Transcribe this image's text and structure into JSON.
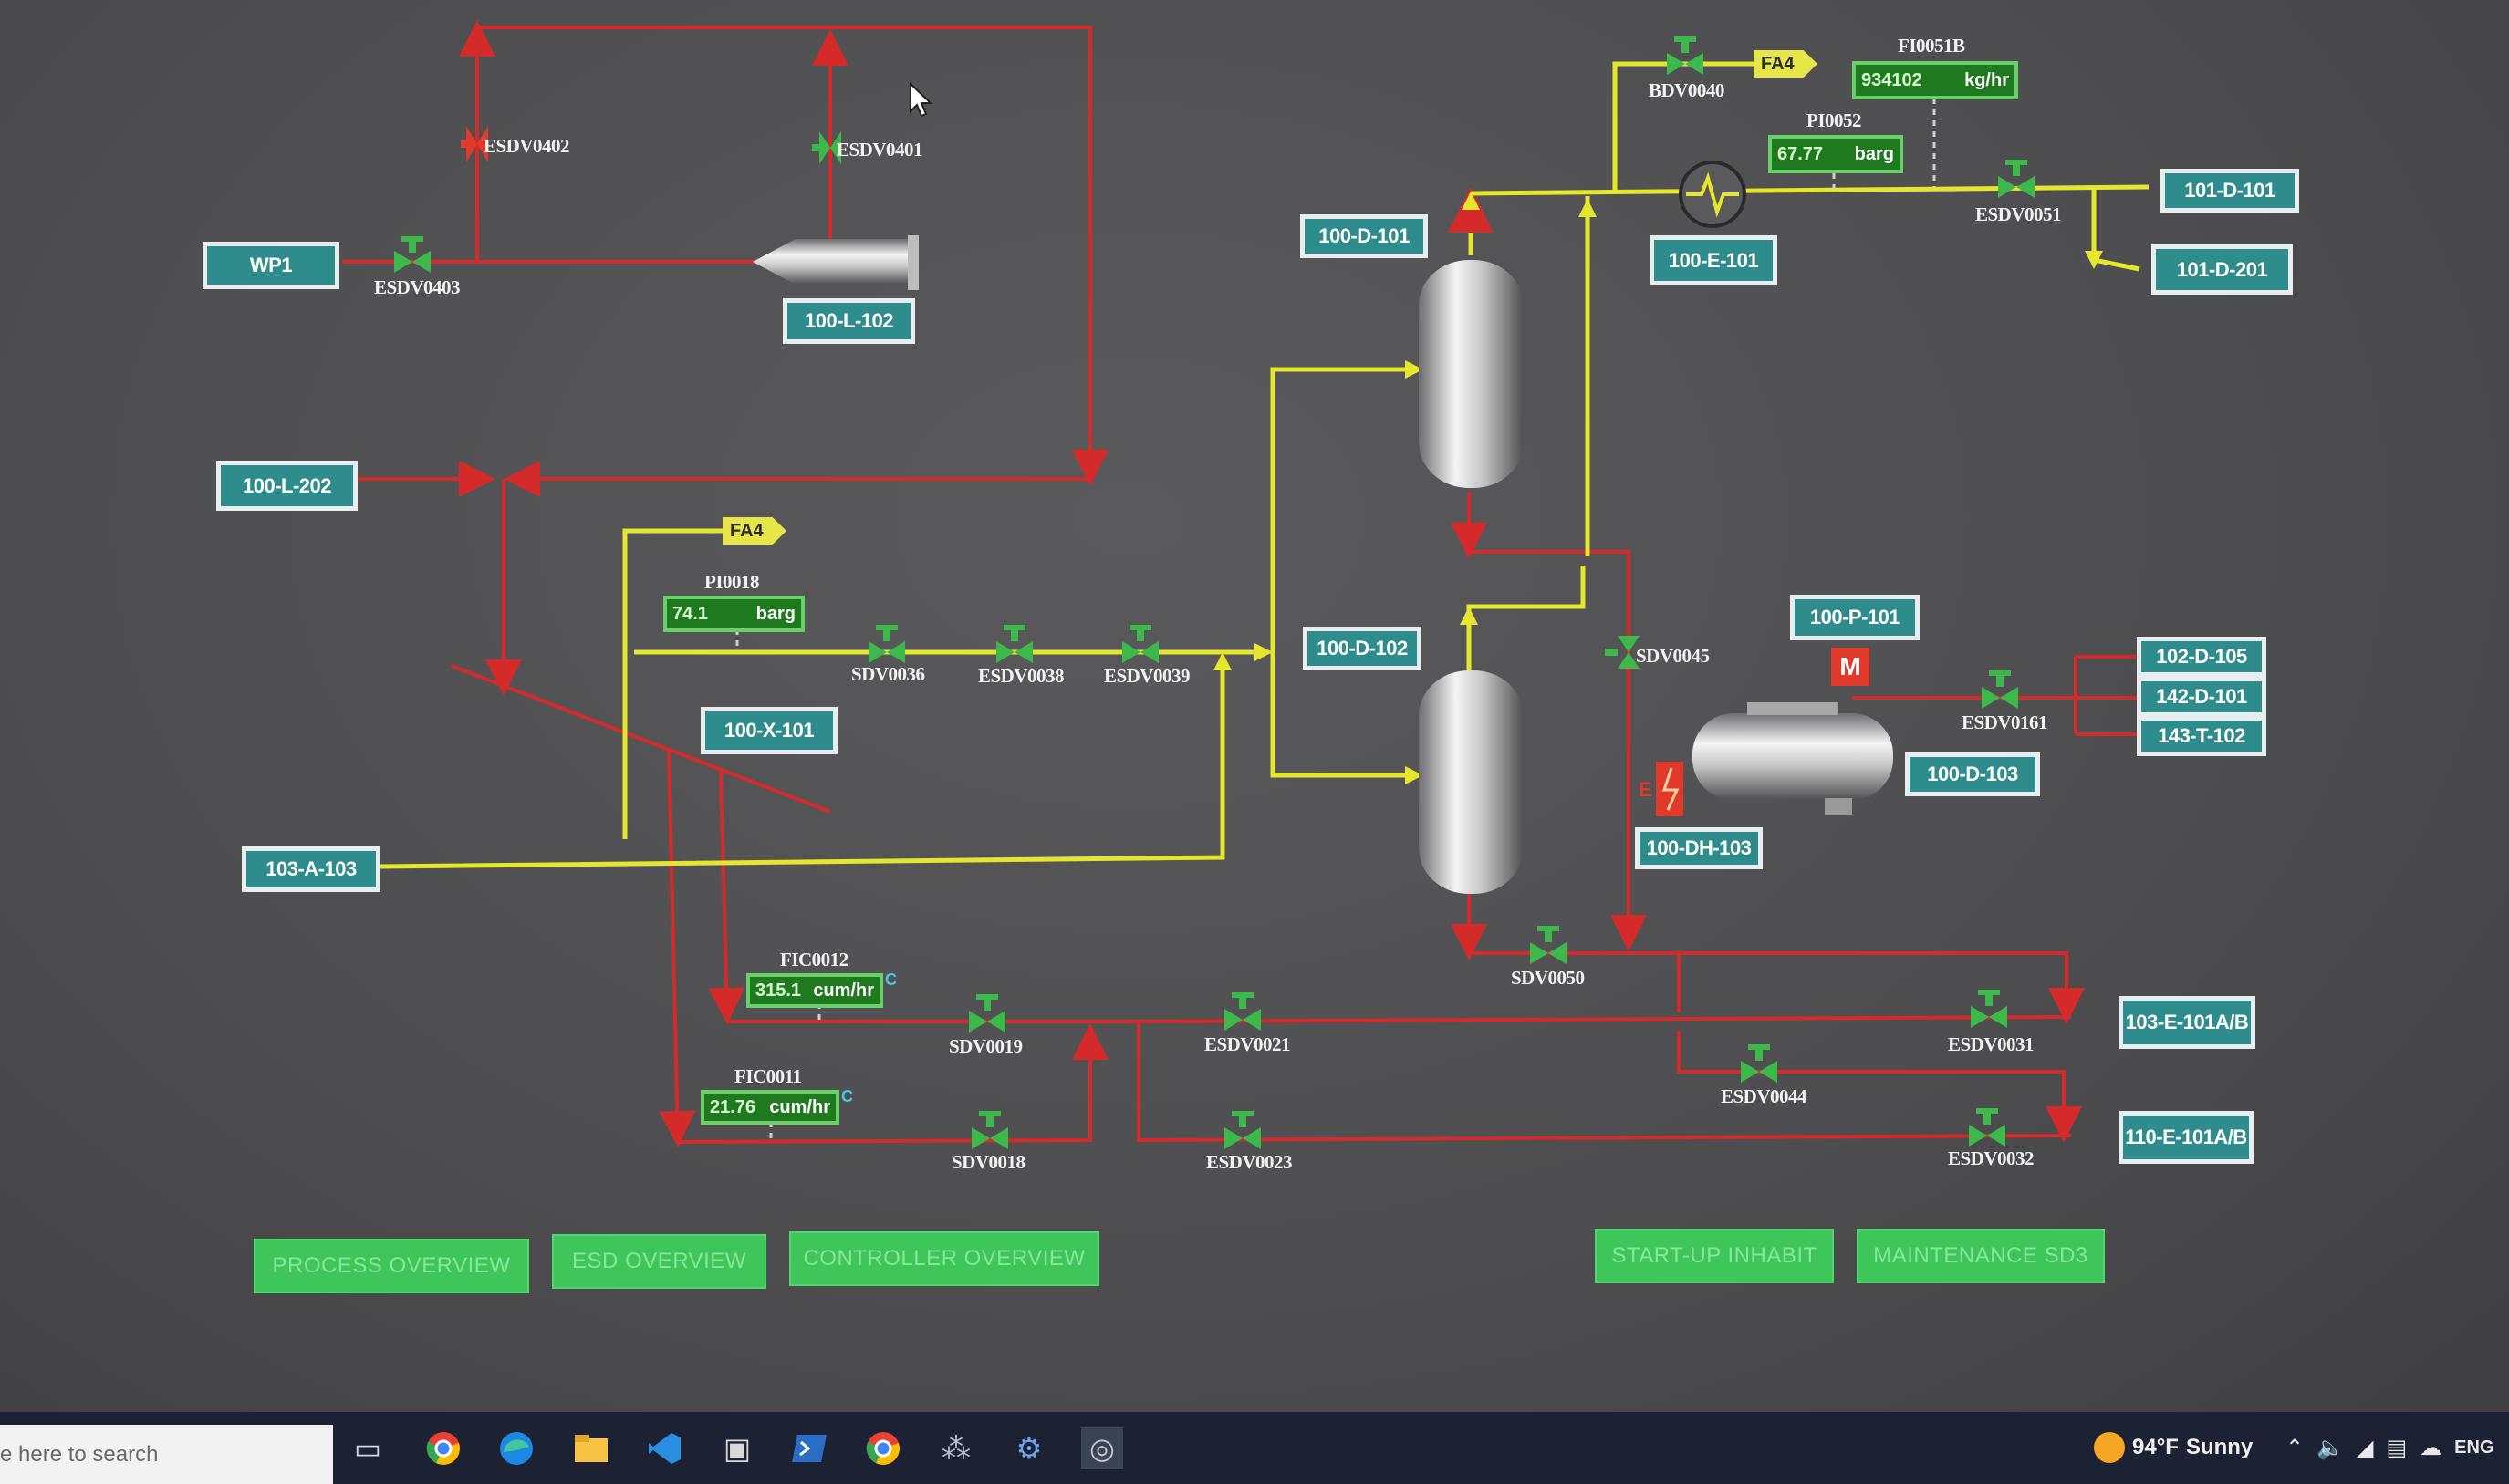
{
  "equipment_tags": {
    "wp1": "WP1",
    "l102": "100-L-102",
    "l202": "100-L-202",
    "x101": "100-X-101",
    "a103": "103-A-103",
    "d101": "100-D-101",
    "d102": "100-D-102",
    "e101": "100-E-101",
    "d101_out": "101-D-101",
    "d201_out": "101-D-201",
    "p101": "100-P-101",
    "d103": "100-D-103",
    "dh103": "100-DH-103",
    "d105": "102-D-105",
    "d101b": "142-D-101",
    "t102": "143-T-102",
    "e101ab_a": "103-E-101A/B",
    "e101ab_b": "110-E-101A/B"
  },
  "valves": {
    "esdv0402": "ESDV0402",
    "esdv0401": "ESDV0401",
    "esdv0403": "ESDV0403",
    "sdv0036": "SDV0036",
    "esdv0038": "ESDV0038",
    "esdv0039": "ESDV0039",
    "bdv0040": "BDV0040",
    "esdv0051": "ESDV0051",
    "sdv0045": "SDV0045",
    "esdv0161": "ESDV0161",
    "sdv0050": "SDV0050",
    "sdv0019": "SDV0019",
    "esdv0021": "ESDV0021",
    "esdv0031": "ESDV0031",
    "esdv0044": "ESDV0044",
    "sdv0018": "SDV0018",
    "esdv0023": "ESDV0023",
    "esdv0032": "ESDV0032"
  },
  "instruments": {
    "fi0051b": {
      "tag": "FI0051B",
      "value": "934102",
      "unit": "kg/hr"
    },
    "pi0052": {
      "tag": "PI0052",
      "value": "67.77",
      "unit": "barg"
    },
    "pi0018": {
      "tag": "PI0018",
      "value": "74.1",
      "unit": "barg"
    },
    "fic0012": {
      "tag": "FIC0012",
      "value": "315.1",
      "unit": "cum/hr",
      "mode": "C"
    },
    "fic0011": {
      "tag": "FIC0011",
      "value": "21.76",
      "unit": "cum/hr",
      "mode": "C"
    }
  },
  "flags": {
    "fa4_top": "FA4",
    "fa4_left": "FA4"
  },
  "motor_label": "M",
  "heater_label": "E",
  "nav": {
    "process_overview": "PROCESS OVERVIEW",
    "esd_overview": "ESD OVERVIEW",
    "controller_overview": "CONTROLLER OVERVIEW",
    "startup_inhabit": "START-UP INHABIT",
    "maintenance_sd3": "MAINTENANCE SD3"
  },
  "taskbar": {
    "search_placeholder": "e here to search",
    "weather_temp": "94°F",
    "weather_text": "Sunny",
    "language": "ENG",
    "icons": [
      "task-view-icon",
      "chrome-icon",
      "edge-icon",
      "file-explorer-icon",
      "vscode-icon",
      "app-icon",
      "powershell-icon",
      "chrome-icon",
      "app-icon",
      "settings-icon",
      "app-icon"
    ]
  },
  "colors": {
    "background": "#4f4f52",
    "hot_line": "#d42a2a",
    "gas_line": "#e6e62e",
    "valve_open": "#3db84a",
    "valve_closed": "#e23a2a",
    "tag_fill": "#2e8c8c",
    "nav_button": "#3fc65a"
  }
}
